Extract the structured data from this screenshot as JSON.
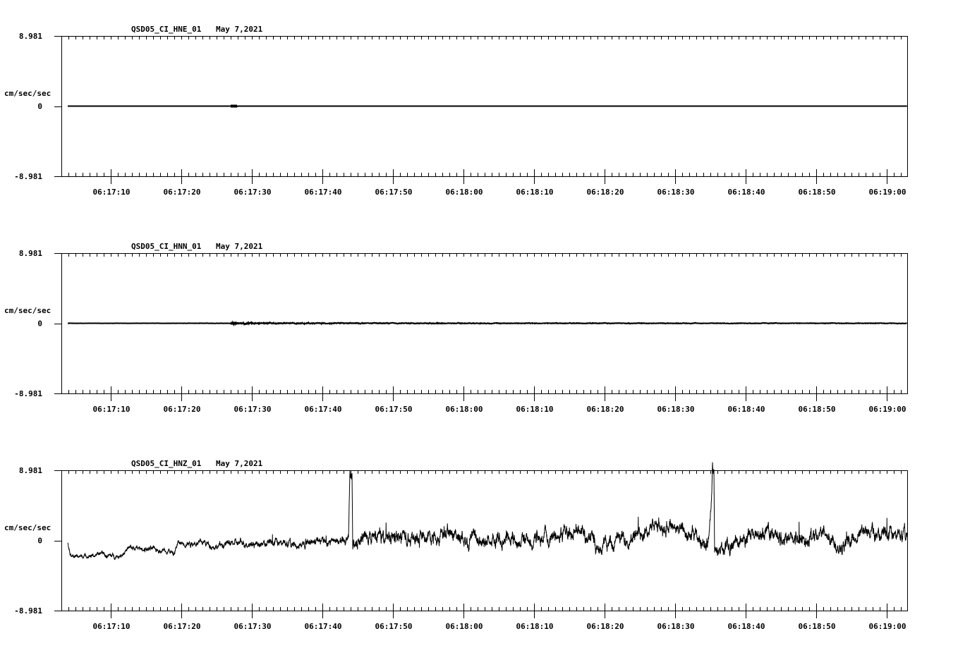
{
  "chart_data": [
    {
      "type": "line",
      "title": "QSD05_CI_HNE_01",
      "date": "May 7,2021",
      "ylabel": "cm/sec/sec",
      "ytick_labels": [
        "8.981",
        "0",
        "-8.981"
      ],
      "ylim": [
        -8.981,
        8.981
      ],
      "xlim_seconds_after_06_17_00": [
        3,
        122.9
      ],
      "xtick_labels": [
        "06:17:10",
        "06:17:20",
        "06:17:30",
        "06:17:40",
        "06:17:50",
        "06:18:00",
        "06:18:10",
        "06:18:20",
        "06:18:30",
        "06:18:40",
        "06:18:50",
        "06:19:00"
      ],
      "series_keypoints": [
        [
          3.9,
          0
        ],
        [
          27.0,
          0
        ],
        [
          27.1,
          0.05
        ],
        [
          27.9,
          -0.05
        ],
        [
          28.0,
          0
        ],
        [
          122.9,
          0
        ]
      ],
      "noise_amplitude": [
        [
          3.9,
          0.0
        ],
        [
          122.9,
          0.0
        ]
      ],
      "line_color": "#000000"
    },
    {
      "type": "line",
      "title": "QSD05_CI_HNN_01",
      "date": "May 7,2021",
      "ylabel": "cm/sec/sec",
      "ytick_labels": [
        "8.981",
        "0",
        "-8.981"
      ],
      "ylim": [
        -8.981,
        8.981
      ],
      "xlim_seconds_after_06_17_00": [
        3,
        122.9
      ],
      "xtick_labels": [
        "06:17:10",
        "06:17:20",
        "06:17:30",
        "06:17:40",
        "06:17:50",
        "06:18:00",
        "06:18:10",
        "06:18:20",
        "06:18:30",
        "06:18:40",
        "06:18:50",
        "06:19:00"
      ],
      "series_keypoints": [
        [
          3.9,
          0
        ],
        [
          122.9,
          0
        ]
      ],
      "noise_amplitude": [
        [
          3.9,
          0.01
        ],
        [
          27.0,
          0.02
        ],
        [
          27.2,
          0.12
        ],
        [
          28.5,
          0.1
        ],
        [
          35,
          0.06
        ],
        [
          60,
          0.04
        ],
        [
          122.9,
          0.03
        ]
      ],
      "line_color": "#000000"
    },
    {
      "type": "line",
      "title": "QSD05_CI_HNZ_01",
      "date": "May 7,2021",
      "ylabel": "cm/sec/sec",
      "ytick_labels": [
        "8.981",
        "0",
        "-8.981"
      ],
      "ylim": [
        -8.981,
        8.981
      ],
      "xlim_seconds_after_06_17_00": [
        3,
        122.9
      ],
      "xtick_labels": [
        "06:17:10",
        "06:17:20",
        "06:17:30",
        "06:17:40",
        "06:17:50",
        "06:18:00",
        "06:18:10",
        "06:18:20",
        "06:18:30",
        "06:18:40",
        "06:18:50",
        "06:19:00"
      ],
      "series_keypoints": [
        [
          3.9,
          -0.27
        ],
        [
          4.3,
          -2.07
        ],
        [
          8.3,
          -1.89
        ],
        [
          8.8,
          -1.44
        ],
        [
          9.3,
          -1.98
        ],
        [
          11.3,
          -1.98
        ],
        [
          12.1,
          -1.35
        ],
        [
          12.5,
          -0.99
        ],
        [
          18.3,
          -1.26
        ],
        [
          18.9,
          -1.89
        ],
        [
          19.5,
          -0.36
        ],
        [
          23.3,
          -0.27
        ],
        [
          24.8,
          -0.81
        ],
        [
          26.8,
          -0.36
        ],
        [
          34.3,
          -0.36
        ],
        [
          36.8,
          -0.72
        ],
        [
          38.8,
          -0.18
        ],
        [
          43.3,
          0.09
        ],
        [
          43.7,
          0.45
        ],
        [
          43.9,
          8.53
        ],
        [
          44.2,
          8.53
        ],
        [
          44.3,
          -0.72
        ],
        [
          45.3,
          0.27
        ],
        [
          48.3,
          0.45
        ],
        [
          54.3,
          0.63
        ],
        [
          58.3,
          0.9
        ],
        [
          62.3,
          -0.27
        ],
        [
          66.3,
          0.36
        ],
        [
          70.3,
          -0.09
        ],
        [
          73.3,
          0.81
        ],
        [
          76.8,
          1.35
        ],
        [
          78.8,
          -0.54
        ],
        [
          80.3,
          -0.45
        ],
        [
          84.3,
          0.63
        ],
        [
          86.8,
          1.71
        ],
        [
          89.8,
          1.98
        ],
        [
          92.3,
          0.63
        ],
        [
          94.8,
          -0.45
        ],
        [
          95.2,
          6.02
        ],
        [
          95.3,
          8.89
        ],
        [
          95.5,
          8.26
        ],
        [
          95.6,
          -1.62
        ],
        [
          96.8,
          -0.99
        ],
        [
          98.8,
          -0.09
        ],
        [
          101.3,
          0.63
        ],
        [
          103.3,
          1.08
        ],
        [
          105.3,
          0.45
        ],
        [
          108.3,
          -0.09
        ],
        [
          110.8,
          1.35
        ],
        [
          112.8,
          -0.45
        ],
        [
          114.3,
          -0.45
        ],
        [
          116.8,
          1.08
        ],
        [
          120.3,
          0.63
        ],
        [
          122.9,
          0.63
        ]
      ],
      "noise_amplitude": [
        [
          3.9,
          0.25
        ],
        [
          25,
          0.45
        ],
        [
          43.5,
          0.6
        ],
        [
          45,
          1.0
        ],
        [
          122.9,
          1.0
        ]
      ],
      "line_color": "#000000"
    }
  ]
}
